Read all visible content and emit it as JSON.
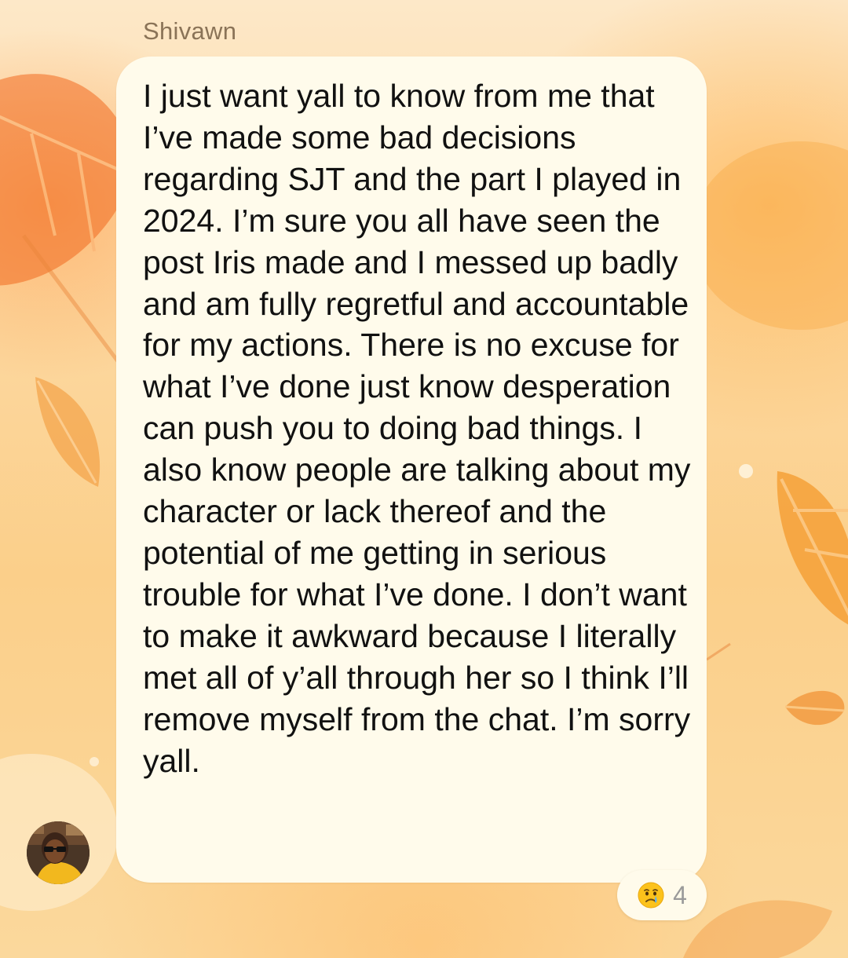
{
  "chat": {
    "sender_name": "Shivawn",
    "message_text": "I just want yall to know from me that I’ve made some bad decisions regarding SJT and the part I played in 2024. I’m sure you all have seen the post Iris made and I messed up badly and am fully regretful and accountable for my actions. There is no excuse for what I’ve done just know desperation can push you to doing bad things. I also know people are talking about my character or lack thereof and the potential of me getting in serious trouble for what I’ve done. I don’t want to make it awkward because I literally met all of y’all through her so I think I’ll remove myself from the chat. I’m sorry yall.",
    "reaction": {
      "icon": "crying-face-icon",
      "count": "4"
    }
  },
  "colors": {
    "bubble_background": "#fffbeb",
    "background_accent": "#f8a640",
    "sender_name": "#8a7357",
    "message_text": "#111111",
    "reaction_count": "#9a9a9a"
  }
}
